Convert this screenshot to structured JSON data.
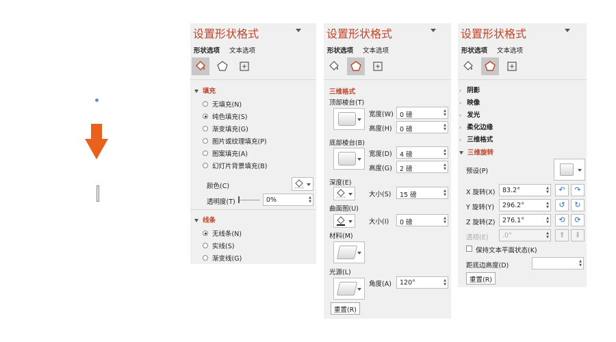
{
  "canvas": {
    "arrow_color": "#e8621e",
    "dot_color": "#6b8fc7"
  },
  "accent": "#c0442a",
  "panel1": {
    "title": "设置形状格式",
    "tabs": [
      "形状选项",
      "文本选项"
    ],
    "icons": [
      "fill-line-icon",
      "effects-icon",
      "size-properties-icon"
    ],
    "fill": {
      "header": "填充",
      "options": [
        "无填充(N)",
        "纯色填充(S)",
        "渐变填充(G)",
        "图片或纹理填充(P)",
        "图案填充(A)",
        "幻灯片背景填充(B)"
      ],
      "selected": 1,
      "color_label": "颜色(C)",
      "transparency_label": "透明度(T)",
      "transparency_value": "0%"
    },
    "line": {
      "header": "线条",
      "options": [
        "无线条(N)",
        "实线(S)",
        "渐变线(G)"
      ],
      "selected": 0
    }
  },
  "panel2": {
    "title": "设置形状格式",
    "tabs": [
      "形状选项",
      "文本选项"
    ],
    "section": "三维格式",
    "top_bevel": {
      "label": "顶部棱台(T)",
      "width_label": "宽度(W)",
      "width": "0 磅",
      "height_label": "高度(H)",
      "height": "0 磅"
    },
    "bottom_bevel": {
      "label": "底部棱台(B)",
      "width_label": "宽度(D)",
      "width": "4 磅",
      "height_label": "高度(G)",
      "height": "2 磅"
    },
    "depth": {
      "label": "深度(E)",
      "size_label": "大小(S)",
      "size": "15 磅"
    },
    "contour": {
      "label": "曲面图(U)",
      "size_label": "大小(I)",
      "size": "0 磅"
    },
    "material_label": "材料(M)",
    "lighting": {
      "label": "光源(L)",
      "angle_label": "角度(A)",
      "angle": "120°"
    },
    "reset": "重置(R)"
  },
  "panel3": {
    "title": "设置形状格式",
    "tabs": [
      "形状选项",
      "文本选项"
    ],
    "collapsed": [
      "阴影",
      "映像",
      "发光",
      "柔化边缘",
      "三维格式"
    ],
    "rotation": {
      "header": "三维旋转",
      "preset_label": "预设(P)",
      "x_label": "X 旋转(X)",
      "x": "83.2°",
      "y_label": "Y 旋转(Y)",
      "y": "296.2°",
      "z_label": "Z 旋转(Z)",
      "z": "276.1°",
      "persp_label": "透视(E)",
      "persp": ".0°",
      "keep_flat_label": "保持文本平面状态(K)",
      "distance_label": "距底边高度(D)",
      "reset": "重置(R)"
    }
  }
}
